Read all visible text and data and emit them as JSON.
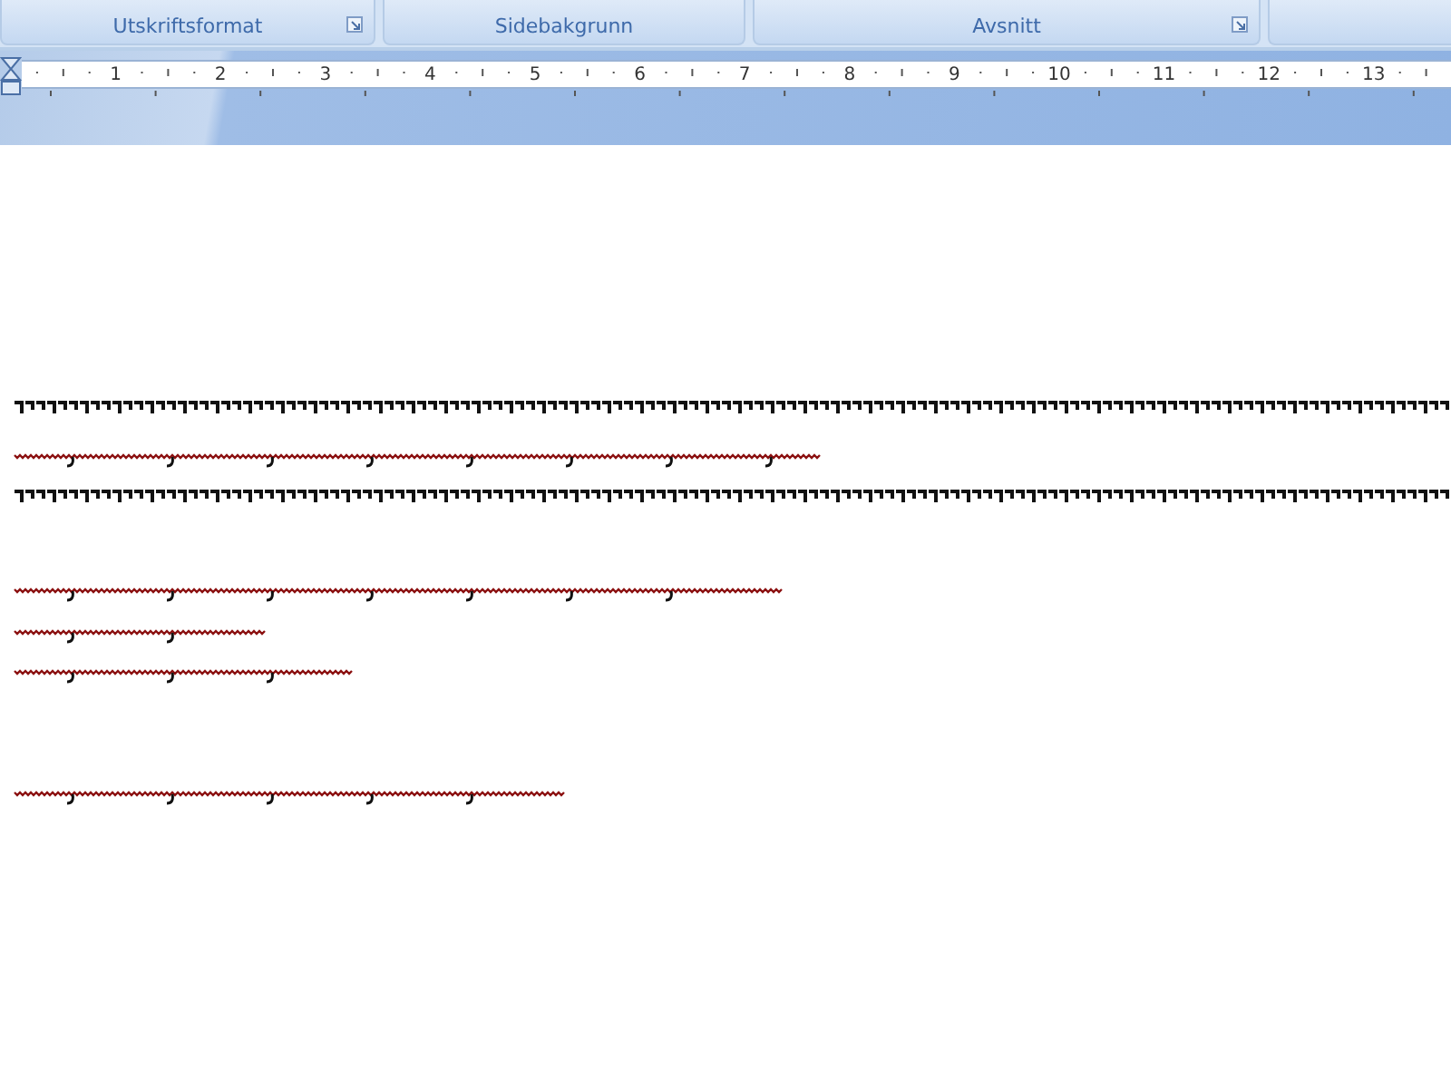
{
  "ribbon": {
    "groups": [
      {
        "label": "Utskriftsformat",
        "launcher": true
      },
      {
        "label": "Sidebakgrunn",
        "launcher": false
      },
      {
        "label": "Avsnitt",
        "launcher": true
      }
    ]
  },
  "ruler": {
    "marks": [
      "1",
      "2",
      "3",
      "4",
      "5",
      "6",
      "7",
      "8",
      "9",
      "10",
      "11",
      "12",
      "13"
    ]
  }
}
